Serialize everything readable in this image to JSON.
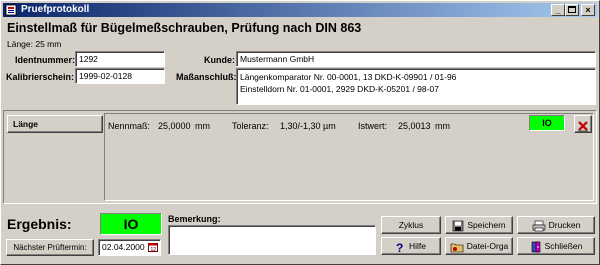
{
  "window": {
    "title": "Pruefprotokoll"
  },
  "header": {
    "title": "Einstellmaß für Bügelmeßschrauben, Prüfung nach DIN 863",
    "subtitle": "Länge: 25 mm"
  },
  "form": {
    "ident_label": "Identnummer:",
    "ident_value": "1292",
    "kalib_label": "Kalibrierschein:",
    "kalib_value": "1999-02-0128",
    "kunde_label": "Kunde:",
    "kunde_value": "Mustermann GmbH",
    "mass_label": "Maßanschluß:",
    "mass_line1": "Längenkomparator Nr. 00-0001, 13 DKD-K-09901 / 01-96",
    "mass_line2": "Einstelldorn Nr. 01-0001, 2929 DKD-K-05201 / 98-07"
  },
  "measurement": {
    "laenge_button": "Länge",
    "nenn_label": "Nennmaß:",
    "nenn_value": "25,0000",
    "nenn_unit": "mm",
    "tol_label": "Toleranz:",
    "tol_value": "1,30/-1,30 µm",
    "ist_label": "Istwert:",
    "ist_value": "25,0013",
    "ist_unit": "mm",
    "status": "IO"
  },
  "footer": {
    "ergebnis_label": "Ergebnis:",
    "ergebnis_value": "IO",
    "next_label": "Nächster Prüftermin:",
    "next_date": "02.04.2000",
    "bemerkung_label": "Bemerkung:",
    "bemerkung_value": ""
  },
  "buttons": {
    "zyklus": "Zyklus",
    "speichern": "Speichern",
    "drucken": "Drucken",
    "hilfe": "Hilfe",
    "datei_orga": "Datei-Orga",
    "schliessen": "Schließen"
  },
  "colors": {
    "ok_green": "#00ff00",
    "title_blue": "#0a246a"
  },
  "icons": [
    "app-icon",
    "minimize-icon",
    "maximize-icon",
    "close-icon",
    "delete-x-icon",
    "calendar-icon",
    "save-icon",
    "print-icon",
    "help-icon",
    "folder-icon",
    "exit-door-icon"
  ]
}
